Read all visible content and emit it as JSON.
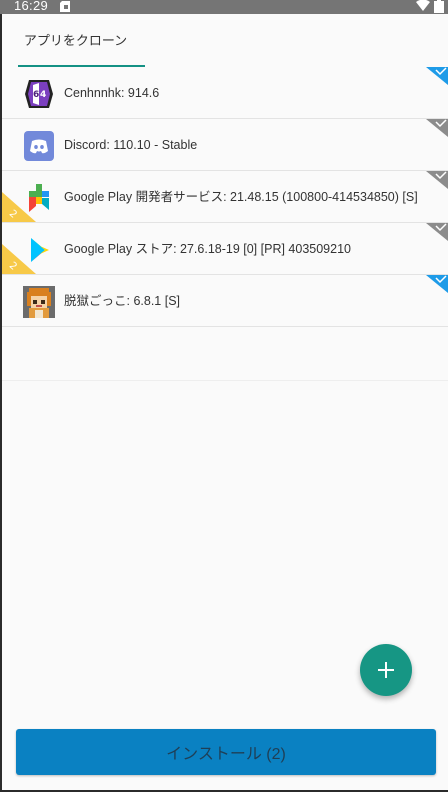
{
  "status_bar": {
    "time": "16:29"
  },
  "tab": {
    "label": "アプリをクローン"
  },
  "apps": [
    {
      "label": "Cenhnnhk: 914.6",
      "icon": "gameguardian-icon"
    },
    {
      "label": "Discord: 110.10 - Stable",
      "icon": "discord-icon"
    },
    {
      "label": "Google Play 開発者サービス: 21.48.15 (100800-414534850) [S]",
      "icon": "play-services-icon",
      "badge": "2"
    },
    {
      "label": "Google Play ストア: 27.6.18-19 [0] [PR] 403509210",
      "icon": "play-store-icon",
      "badge": "2"
    },
    {
      "label": "脱獄ごっこ: 6.8.1 [S]",
      "icon": "game-character-icon"
    }
  ],
  "fab": {
    "icon": "plus-icon"
  },
  "install_button": {
    "label": "インストール (2)"
  },
  "colors": {
    "accent": "#149184",
    "install_button": "#0a81c2",
    "corner_blue": "#1e9be8",
    "corner_grey": "#8c8c8c",
    "badge_yellow": "#f7c948"
  }
}
